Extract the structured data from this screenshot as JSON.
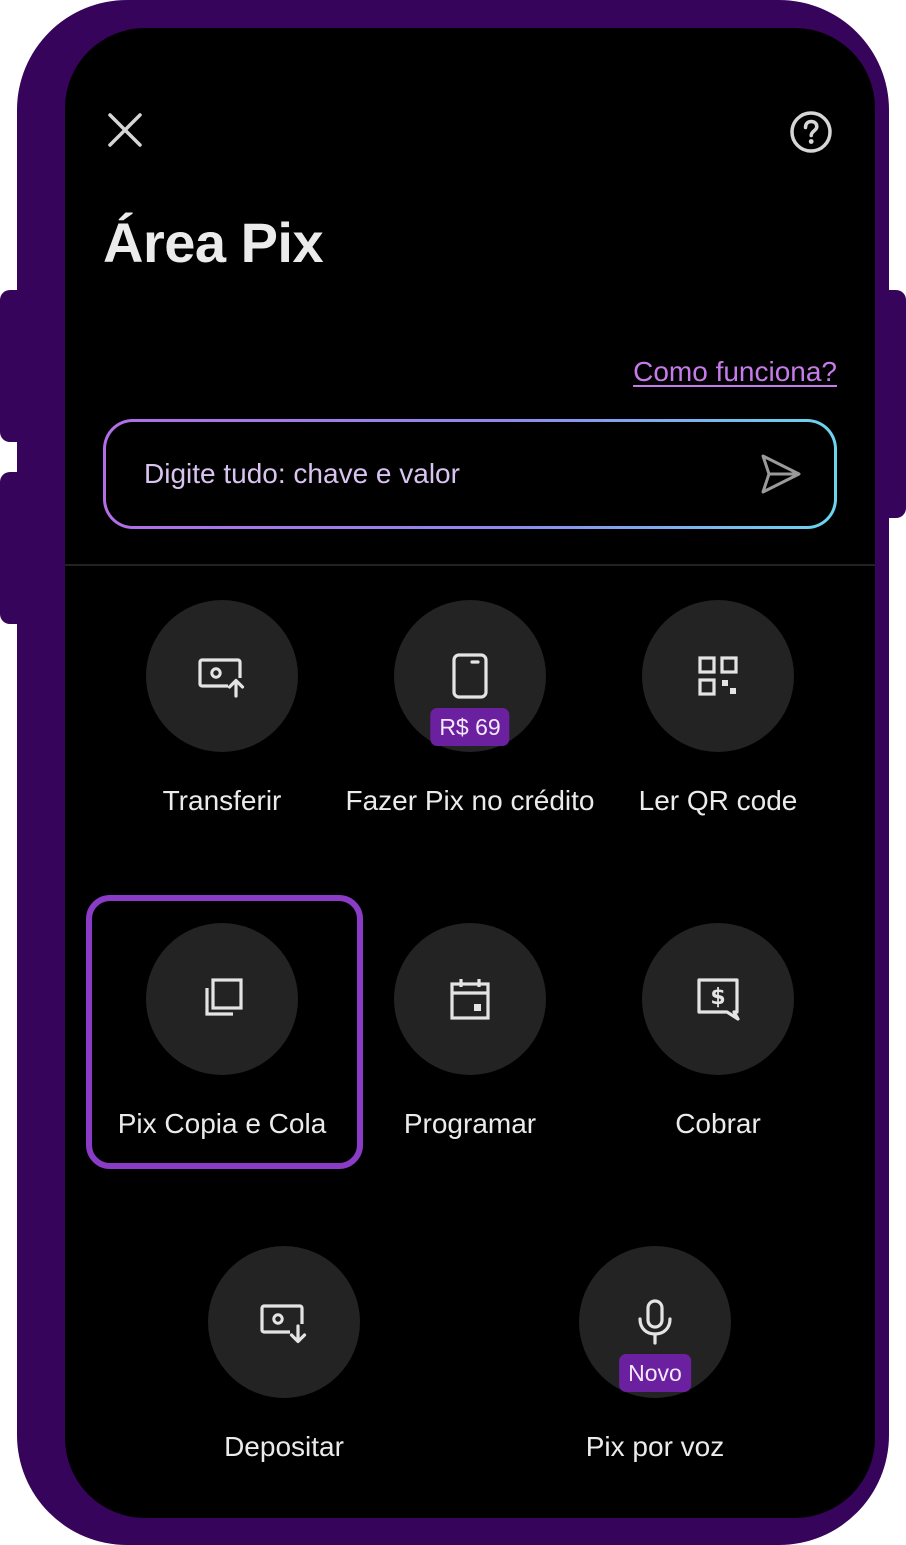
{
  "header": {
    "title": "Área Pix",
    "close_icon": "close-icon",
    "help_icon": "help-circle-icon",
    "help_link": "Como funciona?"
  },
  "search": {
    "placeholder": "Digite tudo: chave e valor",
    "send_icon": "send-icon"
  },
  "actions": [
    {
      "label": "Transferir",
      "icon": "money-send-icon"
    },
    {
      "label": "Fazer Pix no crédito",
      "icon": "card-icon",
      "badge": "R$ 69"
    },
    {
      "label": "Ler QR code",
      "icon": "qr-code-icon"
    },
    {
      "label": "Pix Copia e Cola",
      "icon": "copy-icon",
      "highlighted": true
    },
    {
      "label": "Programar",
      "icon": "calendar-icon"
    },
    {
      "label": "Cobrar",
      "icon": "charge-icon"
    },
    {
      "label": "Depositar",
      "icon": "money-receive-icon"
    },
    {
      "label": "Pix por voz",
      "icon": "microphone-icon",
      "badge": "Novo"
    }
  ],
  "colors": {
    "frame": "#36045a",
    "background": "#000000",
    "circle": "#232323",
    "link": "#c77bea",
    "badge": "#6b20a0",
    "highlight_border": "#8a3cc6",
    "text": "#ebebeb"
  }
}
